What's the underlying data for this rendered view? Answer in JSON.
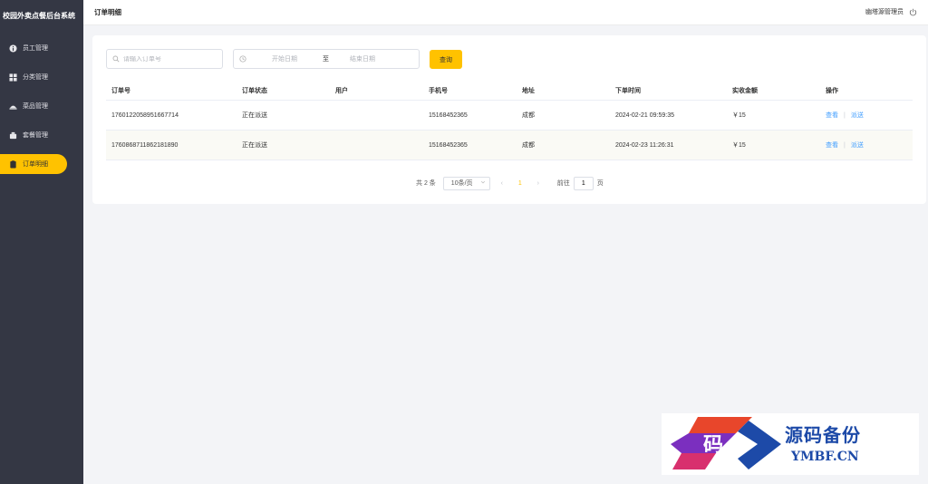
{
  "app": {
    "title": "校园外卖点餐后台系统"
  },
  "sidebar": {
    "items": [
      {
        "label": "员工管理",
        "icon": "info-circle-icon",
        "active": false
      },
      {
        "label": "分类管理",
        "icon": "grid-icon",
        "active": false
      },
      {
        "label": "菜品管理",
        "icon": "dish-icon",
        "active": false
      },
      {
        "label": "套餐管理",
        "icon": "combo-icon",
        "active": false
      },
      {
        "label": "订单明细",
        "icon": "order-icon",
        "active": true
      }
    ]
  },
  "header": {
    "title": "订单明细",
    "user": "幽塔源管理员",
    "logout_icon": "power-icon"
  },
  "filters": {
    "order_placeholder": "请输入订单号",
    "start_placeholder": "开始日期",
    "separator": "至",
    "end_placeholder": "结束日期",
    "query_label": "查询"
  },
  "table": {
    "headers": [
      "订单号",
      "订单状态",
      "用户",
      "手机号",
      "地址",
      "下单时间",
      "实收金额",
      "操作"
    ],
    "rows": [
      {
        "order_no": "1760122058951667714",
        "status": "正在派送",
        "user": "",
        "phone": "15168452365",
        "address": "成都",
        "time": "2024-02-21 09:59:35",
        "amount": "￥15",
        "view": "查看",
        "dispatch": "派送"
      },
      {
        "order_no": "1760868711862181890",
        "status": "正在派送",
        "user": "",
        "phone": "15168452365",
        "address": "成都",
        "time": "2024-02-23 11:26:31",
        "amount": "￥15",
        "view": "查看",
        "dispatch": "派送"
      }
    ]
  },
  "pagination": {
    "total": "共 2 条",
    "page_size": "10条/页",
    "current_page": "1",
    "goto_prefix": "前往",
    "goto_value": "1",
    "goto_suffix": "页"
  },
  "watermark": {
    "name": "源码备份",
    "domain": "YMBF.CN",
    "logo_char": "码"
  },
  "colors": {
    "accent": "#ffc200",
    "sidebar": "#343744",
    "link": "#419eff"
  }
}
